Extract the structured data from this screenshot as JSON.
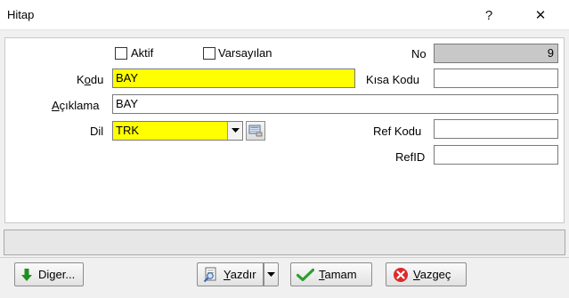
{
  "window": {
    "title": "Hitap",
    "help_label": "?",
    "close_label": "✕"
  },
  "form": {
    "aktif": {
      "label": "Aktif",
      "checked": false
    },
    "varsayilan": {
      "label": "Varsayılan",
      "checked": false
    },
    "no": {
      "label": "No",
      "value": "9"
    },
    "kodu": {
      "label_pre": "K",
      "label_ul": "o",
      "label_post": "du",
      "value": "BAY"
    },
    "kisa_kodu": {
      "label": "Kısa Kodu",
      "value": ""
    },
    "aciklama": {
      "label_ul": "A",
      "label_post": "çıklama",
      "value": "BAY"
    },
    "dil": {
      "label": "Dil",
      "value": "TRK"
    },
    "ref_kodu": {
      "label": "Ref Kodu",
      "value": ""
    },
    "ref_id": {
      "label": "RefID",
      "value": ""
    }
  },
  "status": {
    "text": ""
  },
  "buttons": {
    "diger": {
      "label_pre": "Di",
      "label_ul": "g",
      "label_post": "er..."
    },
    "yazdir": {
      "label_ul": "Y",
      "label_post": "azdır"
    },
    "tamam": {
      "label_ul": "T",
      "label_post": "amam"
    },
    "vazgec": {
      "label_ul": "V",
      "label_post": "azgeç"
    }
  },
  "colors": {
    "required_field": "#ffff00",
    "readonly_field": "#c8c8c8",
    "ok_green": "#2e9e2e",
    "cancel_red": "#d92b2b",
    "arrow_green": "#1f8f1f"
  },
  "icons": {
    "diger": "arrow-down-icon",
    "yazdir": "print-preview-icon",
    "tamam": "checkmark-icon",
    "vazgec": "cancel-icon",
    "lookup": "lookup-icon",
    "dropdown": "chevron-down-icon"
  }
}
